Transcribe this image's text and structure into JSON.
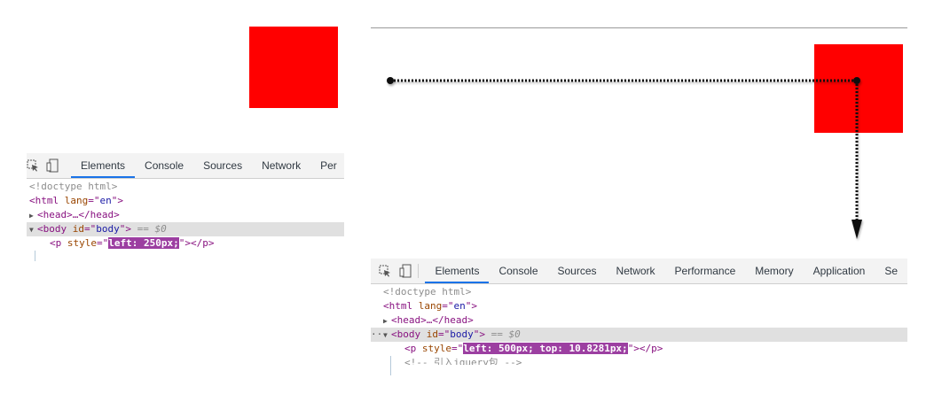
{
  "left_panel": {
    "tabs": [
      "Elements",
      "Console",
      "Sources",
      "Network",
      "Per"
    ],
    "active_tab": "Elements",
    "lines": {
      "doctype": "<!doctype html>",
      "html_open": "<html ",
      "html_attr": "lang",
      "html_eq": "=\"",
      "html_val": "en",
      "html_close": "\">",
      "head": "<head>…</head>",
      "body_open": "<body ",
      "body_attr": "id",
      "body_eq": "=\"",
      "body_val": "body",
      "body_close": "\">",
      "selected_marker": " == $0",
      "p_open": "<p ",
      "p_attr": "style",
      "p_eq": "=\"",
      "p_style": "left: 250px;",
      "p_close": "\"></p>"
    }
  },
  "right_panel": {
    "tabs": [
      "Elements",
      "Console",
      "Sources",
      "Network",
      "Performance",
      "Memory",
      "Application",
      "Se"
    ],
    "active_tab": "Elements",
    "lines": {
      "doctype": "<!doctype html>",
      "html_open": "<html ",
      "html_attr": "lang",
      "html_eq": "=\"",
      "html_val": "en",
      "html_close": "\">",
      "head": "<head>…</head>",
      "dots": "···",
      "body_open": "<body ",
      "body_attr": "id",
      "body_eq": "=\"",
      "body_val": "body",
      "body_close": "\">",
      "selected_marker": " == $0",
      "p_open": "<p ",
      "p_attr": "style",
      "p_eq": "=\"",
      "p_style": "left: 500px; top: 10.8281px;",
      "p_close": "\"></p>",
      "partial": "<!-- 引入jquery包 -->"
    }
  },
  "colors": {
    "square": "#ff0000",
    "highlight": "#9c3fa1",
    "active_tab_underline": "#1a73e8"
  },
  "icons": [
    "inspect-element-icon",
    "device-toolbar-icon"
  ]
}
